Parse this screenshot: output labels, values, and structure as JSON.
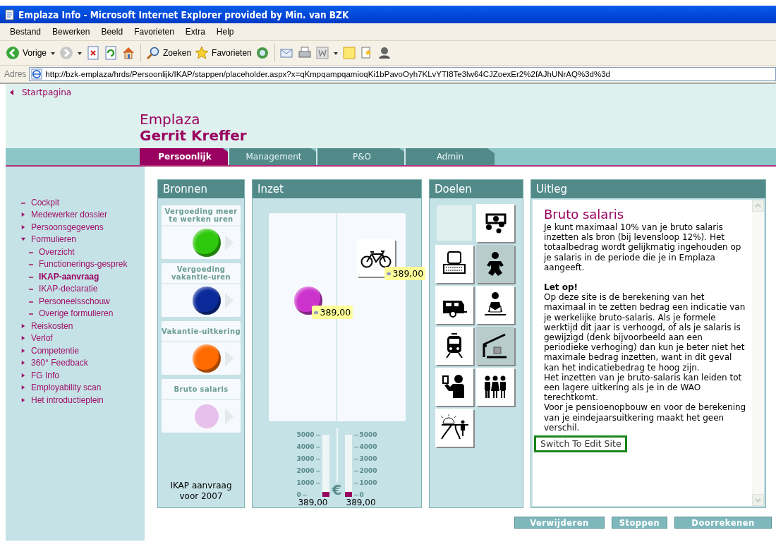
{
  "window": {
    "title": "Emplaza Info - Microsoft Internet Explorer provided by Min. van BZK"
  },
  "menu_bar": [
    "Bestand",
    "Bewerken",
    "Beeld",
    "Favorieten",
    "Extra",
    "Help"
  ],
  "toolbar": [
    {
      "kind": "back",
      "label": "Vorige"
    },
    {
      "kind": "dropdown"
    },
    {
      "kind": "forward"
    },
    {
      "kind": "dropdown"
    },
    {
      "kind": "stop"
    },
    {
      "kind": "refresh"
    },
    {
      "kind": "home"
    },
    {
      "kind": "separator"
    },
    {
      "kind": "search",
      "label": "Zoeken"
    },
    {
      "kind": "favorites",
      "label": "Favorieten"
    },
    {
      "kind": "media"
    },
    {
      "kind": "separator"
    },
    {
      "kind": "mail"
    },
    {
      "kind": "print"
    },
    {
      "kind": "word"
    },
    {
      "kind": "dropdown"
    },
    {
      "kind": "note"
    },
    {
      "kind": "research"
    },
    {
      "kind": "messenger"
    }
  ],
  "address_bar": {
    "label": "Adres",
    "url": "http://bzk-emplaza/hrds/Persoonlijk/IKAP/stappen/placeholder.aspx?x=qKmpqampqamioqKi1bPavoOyh7KLvYTI8Te3lw64CJZoexEr2%2fAJhUNrAQ%3d%3d"
  },
  "header": {
    "back_link": "Startpagina",
    "brand": "Emplaza",
    "user": "Gerrit Kreffer"
  },
  "tabs": [
    {
      "label": "Persoonlijk",
      "selected": true
    },
    {
      "label": "Management",
      "selected": false
    },
    {
      "label": "P&O",
      "selected": false
    },
    {
      "label": "Admin",
      "selected": false
    }
  ],
  "sidebar": {
    "items": [
      {
        "label": "Cockpit",
        "kind": "page",
        "selected": false
      },
      {
        "label": "Medewerker dossier",
        "kind": "folder",
        "expanded": false,
        "selected": false
      },
      {
        "label": "Persoonsgegevens",
        "kind": "folder",
        "expanded": false,
        "selected": false
      },
      {
        "label": "Formulieren",
        "kind": "folder",
        "expanded": true,
        "selected": false,
        "children": [
          {
            "label": "Overzicht",
            "kind": "page",
            "selected": false
          },
          {
            "label": "Functionerings-gesprek",
            "kind": "page",
            "selected": false
          },
          {
            "label": "IKAP-aanvraag",
            "kind": "page",
            "selected": true
          },
          {
            "label": "IKAP-declaratie",
            "kind": "page",
            "selected": false
          },
          {
            "label": "Personeelsschouw",
            "kind": "page",
            "selected": false
          },
          {
            "label": "Overige formulieren",
            "kind": "page",
            "selected": false
          }
        ]
      },
      {
        "label": "Reiskosten",
        "kind": "folder",
        "expanded": false,
        "selected": false
      },
      {
        "label": "Verlof",
        "kind": "folder",
        "expanded": false,
        "selected": false
      },
      {
        "label": "Competentie",
        "kind": "folder",
        "expanded": false,
        "selected": false
      },
      {
        "label": "360° Feedback",
        "kind": "folder",
        "expanded": false,
        "selected": false
      },
      {
        "label": "FG Info",
        "kind": "folder",
        "expanded": false,
        "selected": false
      },
      {
        "label": "Employability scan",
        "kind": "folder",
        "expanded": false,
        "selected": false
      },
      {
        "label": "Het introductieplein",
        "kind": "folder",
        "expanded": false,
        "selected": false
      }
    ]
  },
  "bronnen": {
    "title": "Bronnen",
    "sources": [
      {
        "title": "Vergoeding meer te werken uren",
        "color": "#2fc80c"
      },
      {
        "title": "Vergoeding vakantie-uren",
        "color": "#0a2a9a"
      },
      {
        "title": "Vakantie-uitkering",
        "color": "#ff6a00"
      },
      {
        "title": "Bruto salaris",
        "color": "#e8c0ec"
      }
    ],
    "footer": "IKAP aanvraag voor 2007"
  },
  "inzet": {
    "title": "Inzet",
    "placed": [
      {
        "kind": "ball",
        "color": "#cc33cc",
        "amount": "389,00"
      },
      {
        "kind": "bicycle",
        "amount": "389,00"
      }
    ],
    "gauges": [
      {
        "ticks": [
          "5000",
          "4000",
          "3000",
          "2000",
          "1000",
          "0"
        ],
        "level": 0.078,
        "reading": "389,00"
      },
      {
        "ticks": [
          "5000",
          "4000",
          "3000",
          "2000",
          "1000",
          "0"
        ],
        "level": 0.078,
        "reading": "389,00"
      }
    ],
    "currency": "€"
  },
  "doelen": {
    "title": "Doelen",
    "goals": [
      {
        "kind": "empty",
        "disabled": false
      },
      {
        "kind": "presentation",
        "disabled": false
      },
      {
        "kind": "computer",
        "disabled": false
      },
      {
        "kind": "baby",
        "disabled": true
      },
      {
        "kind": "caravan",
        "disabled": false
      },
      {
        "kind": "reading",
        "disabled": false
      },
      {
        "kind": "train",
        "disabled": false
      },
      {
        "kind": "house",
        "disabled": true
      },
      {
        "kind": "teacher",
        "disabled": false
      },
      {
        "kind": "family",
        "disabled": false
      },
      {
        "kind": "road",
        "disabled": false
      }
    ]
  },
  "uitleg": {
    "title": "Uitleg",
    "heading": "Bruto salaris",
    "paragraphs": [
      {
        "kind": "text",
        "text": "Je kunt maximaal 10% van je bruto salaris inzetten als bron (bij levensloop 12%). Het totaalbedrag wordt gelijkmatig ingehouden op je salaris in de periode die je in Emplaza aangeeft."
      },
      {
        "kind": "heading",
        "text": "Let op!"
      },
      {
        "kind": "line",
        "text": "Op deze site is de berekening van het maximaal in te zetten bedrag een indicatie van je werkelijke bruto-salaris. Als je formele werktijd dit jaar is verhoogd, of als je salaris is gewijzigd (denk bijvoorbeeld aan een periodieke verhoging) dan kun je beter niet het maximale bedrag inzetten, want in dit geval kan het indicatiebedrag te hoog zijn."
      },
      {
        "kind": "line",
        "text": "Het inzetten van je bruto-salaris kan leiden tot een lagere uitkering als je in de WAO terechtkomt."
      },
      {
        "kind": "line",
        "text": "Voor je pensioenopbouw en voor de berekening van je eindejaarsuitkering maakt het geen verschil."
      }
    ],
    "link": "Switch To Edit Site"
  },
  "buttons": [
    "Verwijderen",
    "Stoppen",
    "Doorrekenen"
  ]
}
